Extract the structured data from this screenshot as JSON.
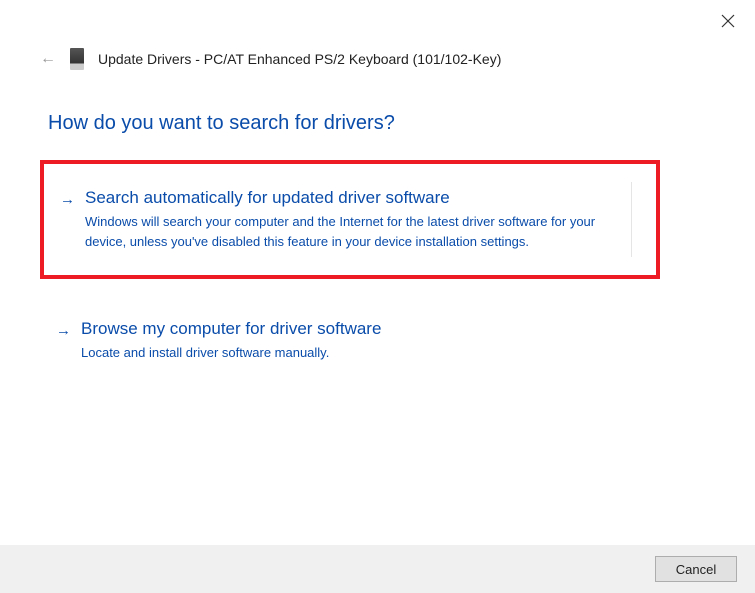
{
  "window": {
    "title": "Update Drivers - PC/AT Enhanced PS/2 Keyboard (101/102-Key)"
  },
  "heading": "How do you want to search for drivers?",
  "options": {
    "auto": {
      "title": "Search automatically for updated driver software",
      "desc": "Windows will search your computer and the Internet for the latest driver software for your device, unless you've disabled this feature in your device installation settings."
    },
    "browse": {
      "title": "Browse my computer for driver software",
      "desc": "Locate and install driver software manually."
    }
  },
  "footer": {
    "cancel": "Cancel"
  }
}
